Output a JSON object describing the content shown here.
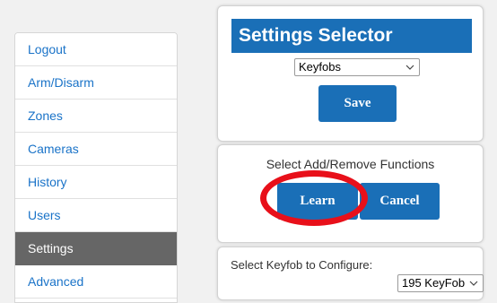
{
  "sidebar": {
    "items": [
      {
        "label": "Logout"
      },
      {
        "label": "Arm/Disarm"
      },
      {
        "label": "Zones"
      },
      {
        "label": "Cameras"
      },
      {
        "label": "History"
      },
      {
        "label": "Users"
      },
      {
        "label": "Settings",
        "active": true
      },
      {
        "label": "Advanced"
      }
    ]
  },
  "settings_panel": {
    "title": "Settings Selector",
    "selector_value": "Keyfobs",
    "save_label": "Save"
  },
  "functions_panel": {
    "text": "Select Add/Remove Functions",
    "learn_label": "Learn",
    "cancel_label": "Cancel"
  },
  "configure_panel": {
    "label": "Select Keyfob to Configure:",
    "keyfob_value": "195 KeyFob"
  },
  "colors": {
    "accent": "#1a6fb7",
    "link": "#1a73c8",
    "active_bg": "#666666",
    "annotation": "#e8101a"
  },
  "icons": [
    "chevron-down-icon"
  ]
}
